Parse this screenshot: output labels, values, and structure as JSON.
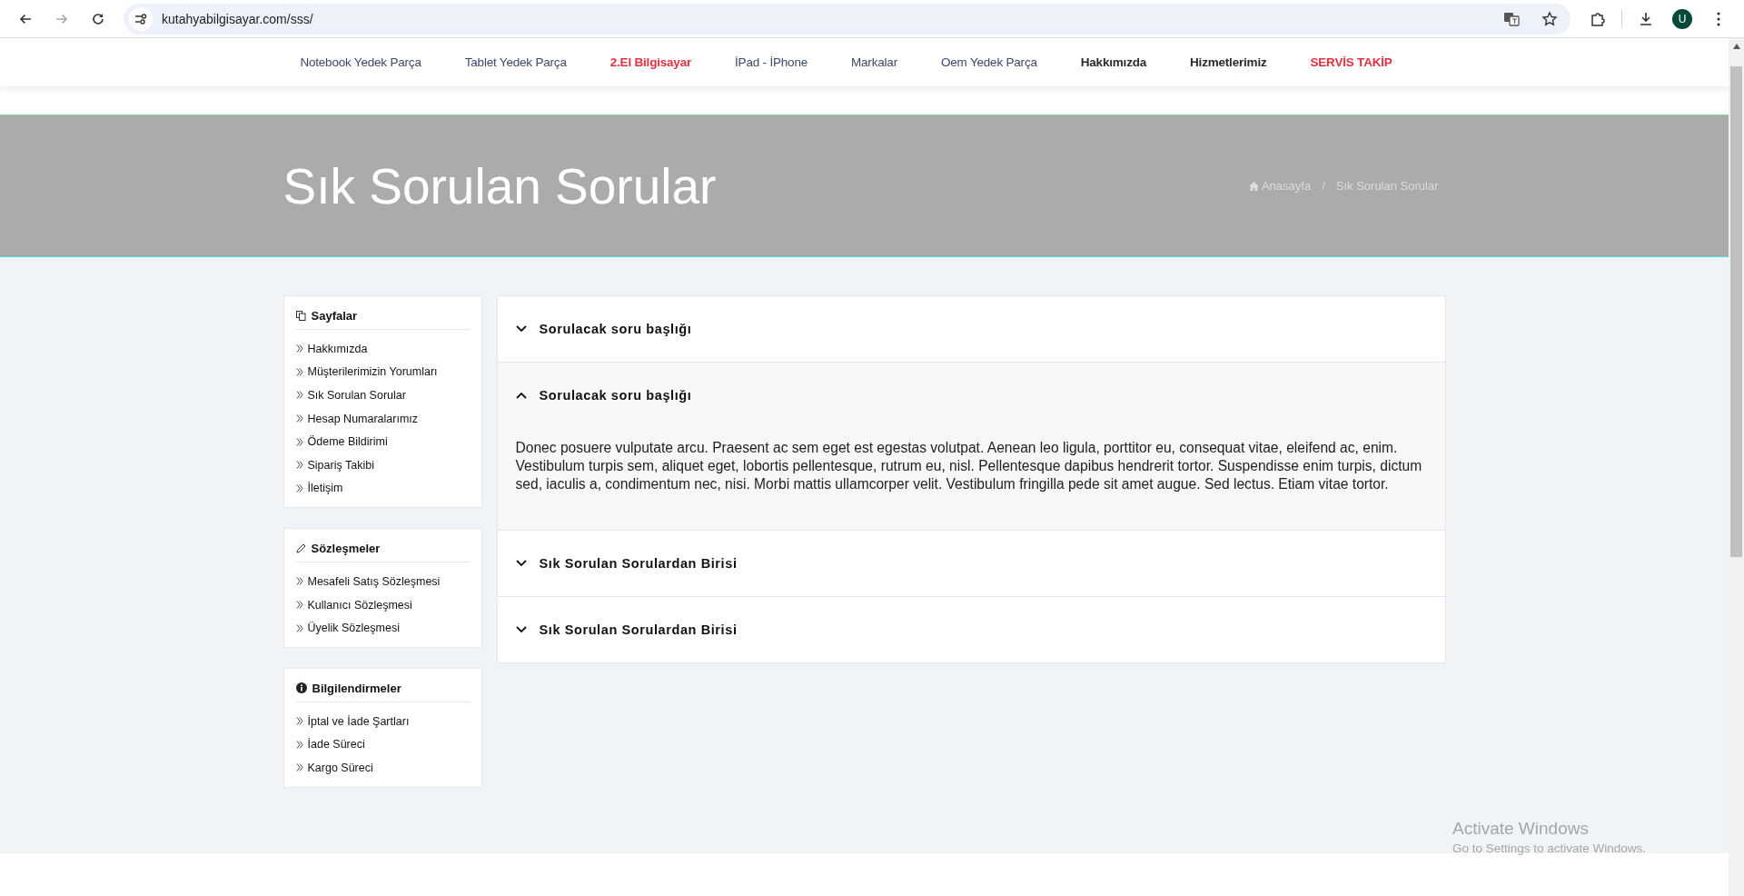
{
  "browser": {
    "url": "kutahyabilgisayar.com/sss/",
    "forward_disabled": true,
    "profile_initial": "U"
  },
  "nav": [
    {
      "label": "Notebook Yedek Parça",
      "kind": "normal"
    },
    {
      "label": "Tablet Yedek Parça",
      "kind": "normal"
    },
    {
      "label": "2.El Bilgisayar",
      "kind": "highlight"
    },
    {
      "label": "İPad - İPhone",
      "kind": "normal"
    },
    {
      "label": "Markalar",
      "kind": "normal"
    },
    {
      "label": "Oem Yedek Parça",
      "kind": "normal"
    },
    {
      "label": "Hakkımızda",
      "kind": "bold"
    },
    {
      "label": "Hizmetlerimiz",
      "kind": "bold"
    },
    {
      "label": "SERVİS TAKİP",
      "kind": "highlight"
    }
  ],
  "page_header": {
    "title": "Sık Sorulan Sorular",
    "breadcrumb": [
      {
        "label": "Anasayfa",
        "kind": "home"
      },
      {
        "label": "/",
        "kind": "separator"
      },
      {
        "label": "Sık Sorulan Sorular",
        "kind": "current"
      }
    ]
  },
  "sidebar": [
    {
      "title": "Sayfalar",
      "kind": "pages",
      "items": [
        "Hakkımızda",
        "Müşterilerimizin Yorumları",
        "Sık Sorulan Sorular",
        "Hesap Numaralarımız",
        "Ödeme Bildirimi",
        "Sipariş Takibi",
        "İletişim"
      ]
    },
    {
      "title": "Sözleşmeler",
      "kind": "pencil",
      "items": [
        "Mesafeli Satış Sözleşmesi",
        "Kullanıcı Sözleşmesi",
        "Üyelik Sözleşmesi"
      ]
    },
    {
      "title": "Bilgilendirmeler",
      "kind": "info",
      "items": [
        "İptal ve İade Şartları",
        "İade Süreci",
        "Kargo Süreci"
      ]
    }
  ],
  "faq": [
    {
      "question": "Sorulacak soru başlığı",
      "expanded": false
    },
    {
      "question": "Sorulacak soru başlığı",
      "expanded": true,
      "answer": "Donec posuere vulputate arcu. Praesent ac sem eget est egestas volutpat. Aenean leo ligula, porttitor eu, consequat vitae, eleifend ac, enim. Vestibulum turpis sem, aliquet eget, lobortis pellentesque, rutrum eu, nisl. Pellentesque dapibus hendrerit tortor. Suspendisse enim turpis, dictum sed, iaculis a, condimentum nec, nisi. Morbi mattis ullamcorper velit. Vestibulum fringilla pede sit amet augue. Sed lectus. Etiam vitae tortor."
    },
    {
      "question": "Sık Sorulan Sorulardan Birisi",
      "expanded": false
    },
    {
      "question": "Sık Sorulan Sorulardan Birisi",
      "expanded": false
    }
  ],
  "os_notice": {
    "title": "Activate Windows",
    "subtitle": "Go to Settings to activate Windows."
  }
}
